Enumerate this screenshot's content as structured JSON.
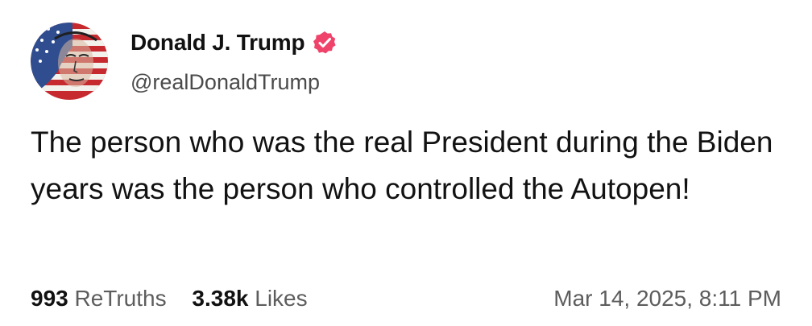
{
  "author": {
    "display_name": "Donald J. Trump",
    "handle": "@realDonaldTrump",
    "verified_badge": "verified-badge-icon",
    "verified_color": "#f0436b"
  },
  "post": {
    "text": "The person who was the real President during the Biden years was the person who controlled the Autopen!"
  },
  "stats": {
    "retruths_count": "993",
    "retruths_label": "ReTruths",
    "likes_count": "3.38k",
    "likes_label": "Likes"
  },
  "timestamp": "Mar 14, 2025, 8:11 PM"
}
